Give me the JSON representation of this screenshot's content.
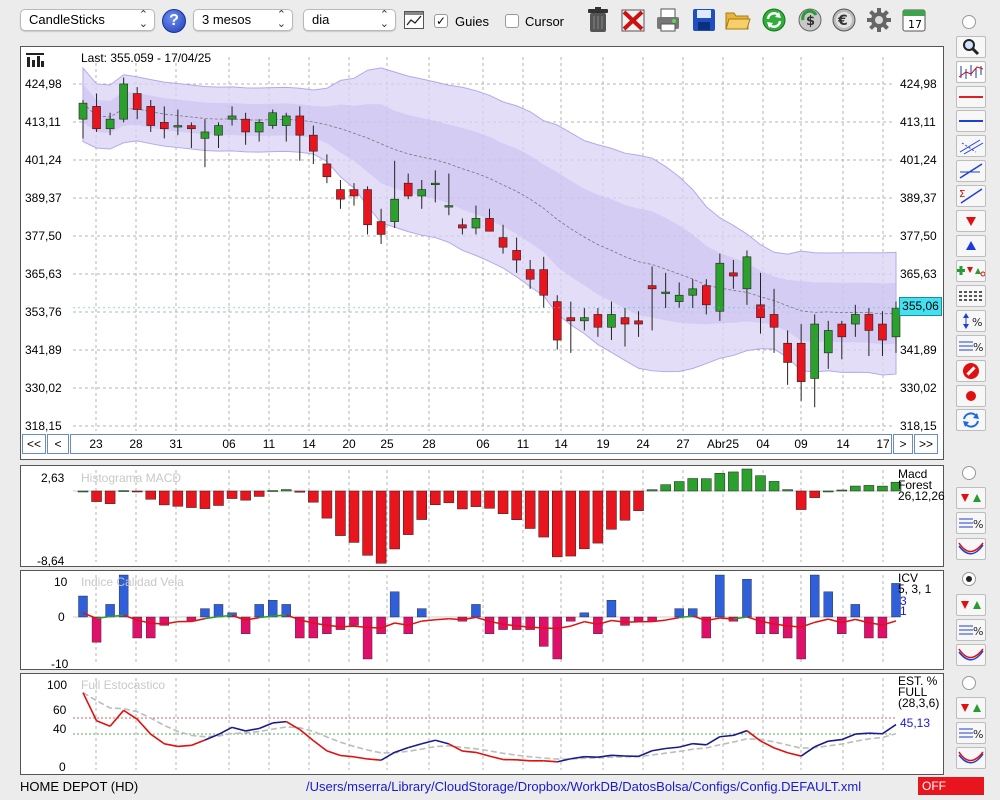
{
  "toolbar": {
    "chart_type": "CandleSticks",
    "period": "3 mesos",
    "interval": "dia",
    "guides_label": "Guies",
    "guides_checked": true,
    "cursor_label": "Cursor",
    "cursor_checked": false,
    "calendar_day": "17"
  },
  "main_chart": {
    "last_label": "Last: 355.059 - 17/04/25",
    "y_ticks": [
      "424,98",
      "413,11",
      "401,24",
      "389,37",
      "377,50",
      "365,63",
      "353,76",
      "341,89",
      "330,02",
      "318,15"
    ],
    "last_value_badge": "355,06",
    "x_labels": [
      "23",
      "28",
      "31",
      "06",
      "11",
      "14",
      "20",
      "25",
      "28",
      "06",
      "11",
      "14",
      "19",
      "24",
      "27",
      "Abr25",
      "04",
      "09",
      "14",
      "17"
    ],
    "nav": {
      "first": "<<",
      "prev": "<",
      "next": ">",
      "last": ">>"
    }
  },
  "macd": {
    "title": "Histograma MACD",
    "max_label": "2,63",
    "min_label": "-8,64",
    "name_lines": [
      "Macd",
      "Forest"
    ],
    "params": "26,12,26"
  },
  "icv": {
    "title": "Indice Calidad Vela",
    "y_ticks": [
      "10",
      "0",
      "-10"
    ],
    "name": "ICV",
    "params": "5, 3, 1",
    "values": [
      "3",
      "1"
    ]
  },
  "stoch": {
    "title": "Full Estocastico",
    "y_ticks": [
      "100",
      "60",
      "40",
      "0"
    ],
    "name_lines": [
      "EST. %",
      "FULL"
    ],
    "params": "(28,3,6)",
    "value": "45,13"
  },
  "status": {
    "symbol": "HOME DEPOT (HD)",
    "path": "/Users/mserra/Library/CloudStorage/Dropbox/WorkDB/DatosBolsa/Configs/Config.DEFAULT.xml",
    "off": "OFF"
  },
  "colors": {
    "up": "#2ca02c",
    "down": "#e8141e",
    "band": "#d9d2f5",
    "blue_bar": "#2f5fd9",
    "pink_bar": "#e0106a"
  },
  "chart_data": {
    "type": "candlestick",
    "categories_visible": [
      "23",
      "28",
      "31",
      "06",
      "11",
      "14",
      "20",
      "25",
      "28",
      "06",
      "11",
      "14",
      "19",
      "24",
      "27",
      "Abr25",
      "04",
      "09",
      "14",
      "17"
    ],
    "last_close": 355.059,
    "last_date": "17/04/25",
    "ylim": [
      318.15,
      424.98
    ],
    "candles": [
      [
        414,
        420,
        408,
        419
      ],
      [
        418,
        422,
        410,
        411
      ],
      [
        411,
        416,
        409,
        414
      ],
      [
        414,
        427,
        413,
        425
      ],
      [
        422,
        424,
        414,
        417
      ],
      [
        418,
        420,
        410,
        412
      ],
      [
        413,
        418,
        408,
        411
      ],
      [
        412,
        417,
        409,
        412
      ],
      [
        412,
        413,
        405,
        411
      ],
      [
        408,
        414,
        399,
        410
      ],
      [
        409,
        413,
        405,
        412
      ],
      [
        414,
        418,
        412,
        415
      ],
      [
        414,
        416,
        406,
        410
      ],
      [
        410,
        414,
        407,
        413
      ],
      [
        412,
        417,
        411,
        416
      ],
      [
        412,
        416,
        407,
        415
      ],
      [
        415,
        418,
        401,
        409
      ],
      [
        409,
        412,
        400,
        404
      ],
      [
        400,
        403,
        394,
        396
      ],
      [
        392,
        395,
        386,
        389
      ],
      [
        392,
        394,
        387,
        390
      ],
      [
        392,
        393,
        378,
        381
      ],
      [
        382,
        386,
        375,
        378
      ],
      [
        382,
        401,
        380,
        389
      ],
      [
        394,
        397,
        389,
        390
      ],
      [
        390,
        395,
        386,
        392
      ],
      [
        394,
        398,
        388,
        394
      ],
      [
        387,
        397,
        384,
        387
      ],
      [
        381,
        383,
        378,
        380
      ],
      [
        380,
        387,
        378,
        383
      ],
      [
        383,
        386,
        379,
        379
      ],
      [
        377,
        381,
        372,
        374
      ],
      [
        373,
        377,
        366,
        370
      ],
      [
        367,
        370,
        361,
        364
      ],
      [
        367,
        371,
        355,
        359
      ],
      [
        357,
        359,
        342,
        345
      ],
      [
        352,
        357,
        341,
        351
      ],
      [
        351,
        355,
        348,
        352
      ],
      [
        353,
        355,
        346,
        349
      ],
      [
        349,
        357,
        345,
        353
      ],
      [
        352,
        355,
        343,
        350
      ],
      [
        351,
        354,
        346,
        350
      ],
      [
        362,
        368,
        348,
        361
      ],
      [
        360,
        366,
        355,
        360
      ],
      [
        357,
        363,
        355,
        359
      ],
      [
        359,
        364,
        355,
        361
      ],
      [
        362,
        364,
        353,
        356
      ],
      [
        354,
        372,
        351,
        369
      ],
      [
        366,
        370,
        361,
        365
      ],
      [
        361,
        373,
        356,
        371
      ],
      [
        356,
        366,
        347,
        352
      ],
      [
        353,
        361,
        341,
        349
      ],
      [
        344,
        348,
        331,
        338
      ],
      [
        344,
        350,
        326,
        332
      ],
      [
        333,
        353,
        324,
        350
      ],
      [
        341,
        351,
        336,
        348
      ],
      [
        350,
        351,
        339,
        346
      ],
      [
        350,
        356,
        346,
        353
      ],
      [
        353,
        355,
        340,
        348
      ],
      [
        350,
        354,
        340,
        345
      ],
      [
        346,
        357,
        341,
        355
      ]
    ],
    "macd_histogram_range": [
      -8.64,
      2.63
    ],
    "stochastic_levels": [
      60,
      40
    ],
    "stochastic_last": 45.13
  }
}
